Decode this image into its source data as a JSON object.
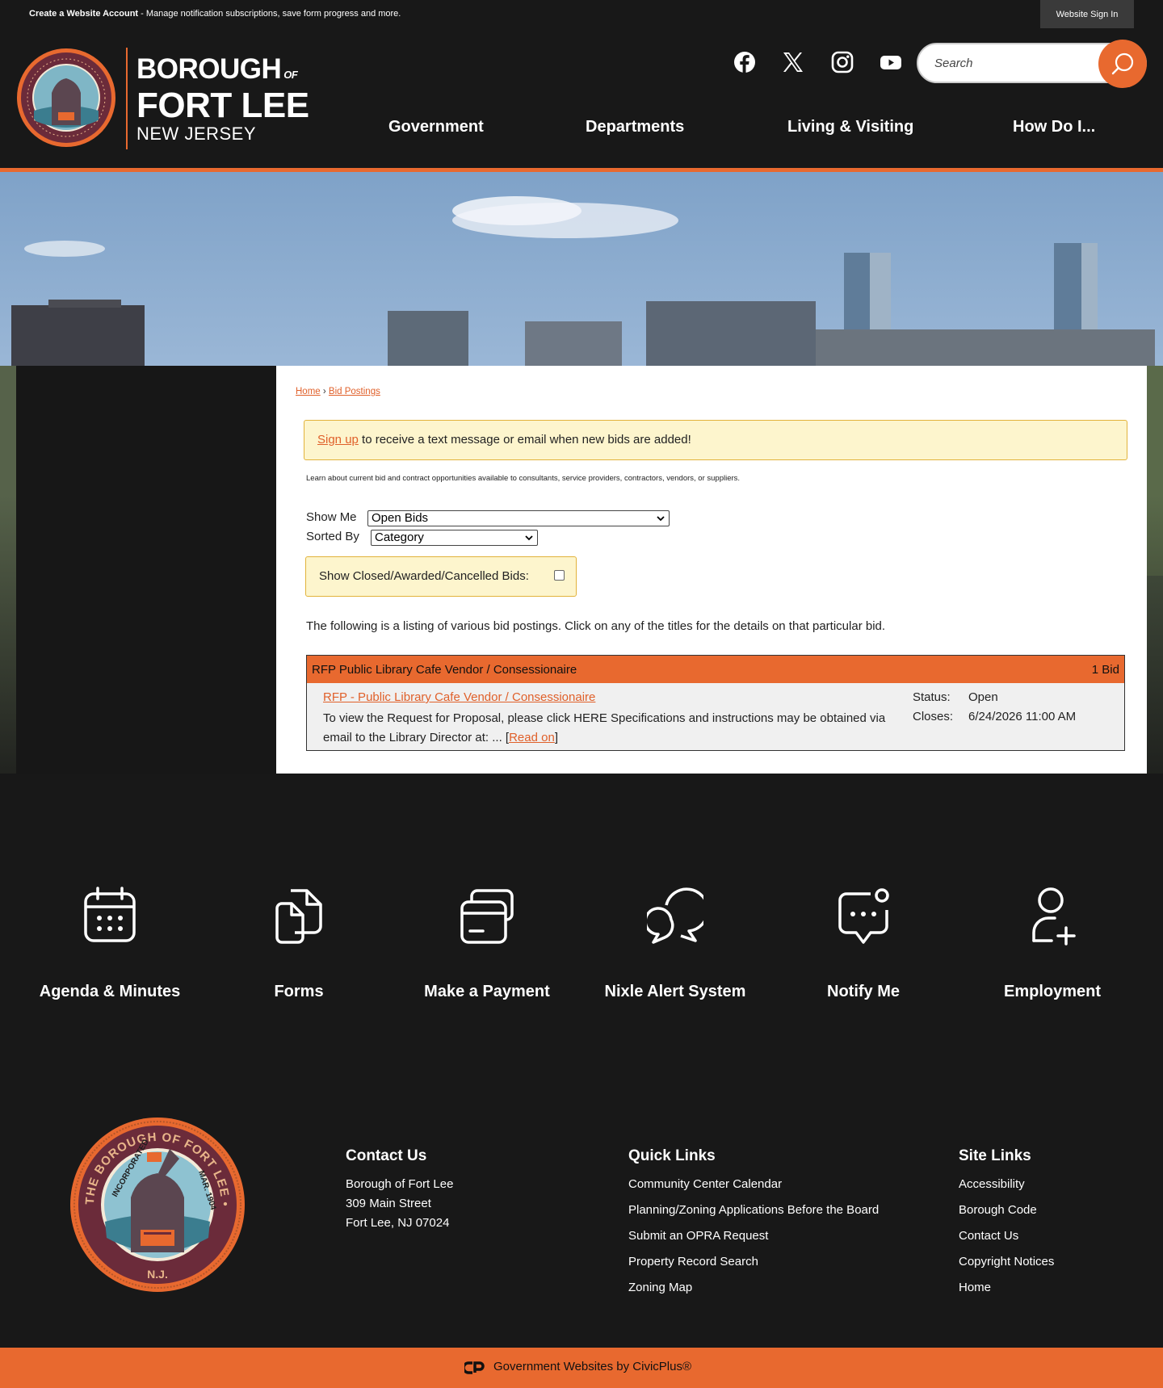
{
  "topbar": {
    "create_account": "Create a Website Account",
    "create_account_desc": " - Manage notification subscriptions, save form progress and more.",
    "sign_in": "Website Sign In"
  },
  "logo": {
    "line1": "BOROUGH",
    "of": "OF",
    "line2": "FORT LEE",
    "line3": "NEW JERSEY"
  },
  "social": [
    "facebook-icon",
    "x-twitter-icon",
    "instagram-icon",
    "youtube-icon"
  ],
  "search": {
    "placeholder": "Search"
  },
  "nav": [
    "Government",
    "Departments",
    "Living & Visiting",
    "How Do I..."
  ],
  "breadcrumb": {
    "home": "Home",
    "sep": " › ",
    "current": "Bid Postings"
  },
  "signup": {
    "link": "Sign up",
    "text": " to receive a text message or email when new bids are added!"
  },
  "learn": "Learn about current bid and contract opportunities available to consultants, service providers, contractors, vendors, or suppliers.",
  "filters": {
    "show_me_label": "Show Me",
    "show_me_value": "Open Bids",
    "sorted_by_label": "Sorted By",
    "sorted_by_value": "Category",
    "closed_label": "Show Closed/Awarded/Cancelled Bids:"
  },
  "listing_intro": "The following is a listing of various bid postings. Click on any of the titles for the details on that particular bid.",
  "category": {
    "title": "RFP Public Library Cafe Vendor / Consessionaire",
    "count": "1 Bid"
  },
  "bid": {
    "title": "RFP - Public Library Cafe Vendor / Consessionaire",
    "desc": "To view the Request for Proposal, please click HERE Specifications and instructions may be obtained via email to the Library Director at: ... [",
    "read_on": "Read on",
    "desc_end": "]",
    "status_label": "Status:",
    "status_value": "Open",
    "closes_label": "Closes:",
    "closes_value": "6/24/2026 11:00 AM"
  },
  "quick_links": [
    {
      "label": "Agenda & Minutes",
      "icon": "calendar-icon"
    },
    {
      "label": "Forms",
      "icon": "forms-icon"
    },
    {
      "label": "Make a Payment",
      "icon": "payment-card-icon"
    },
    {
      "label": "Nixle Alert System",
      "icon": "chat-bubbles-icon"
    },
    {
      "label": "Notify Me",
      "icon": "notification-message-icon"
    },
    {
      "label": "Employment",
      "icon": "add-user-icon"
    }
  ],
  "footer": {
    "contact": {
      "heading": "Contact Us",
      "lines": [
        "Borough of Fort Lee",
        "309 Main Street",
        "Fort Lee, NJ 07024"
      ]
    },
    "quick": {
      "heading": "Quick Links",
      "links": [
        "Community Center Calendar",
        "Planning/Zoning Applications Before the Board",
        "Submit an OPRA Request",
        "Property Record Search",
        "Zoning Map"
      ]
    },
    "site": {
      "heading": "Site Links",
      "links": [
        "Accessibility",
        "Borough Code",
        "Contact Us",
        "Copyright Notices",
        "Home"
      ]
    },
    "powered": "Government Websites by CivicPlus®"
  },
  "seal": {
    "top_text": "THE BOROUGH OF FORT LEE • BERGEN COUNTY",
    "incorporated": "INCORPORATED",
    "date": "MAR. 1904",
    "state": "N.J."
  },
  "colors": {
    "accent": "#e8692f",
    "dark": "#181818",
    "notice_bg": "#fdf5cd",
    "notice_border": "#e2b33b"
  }
}
